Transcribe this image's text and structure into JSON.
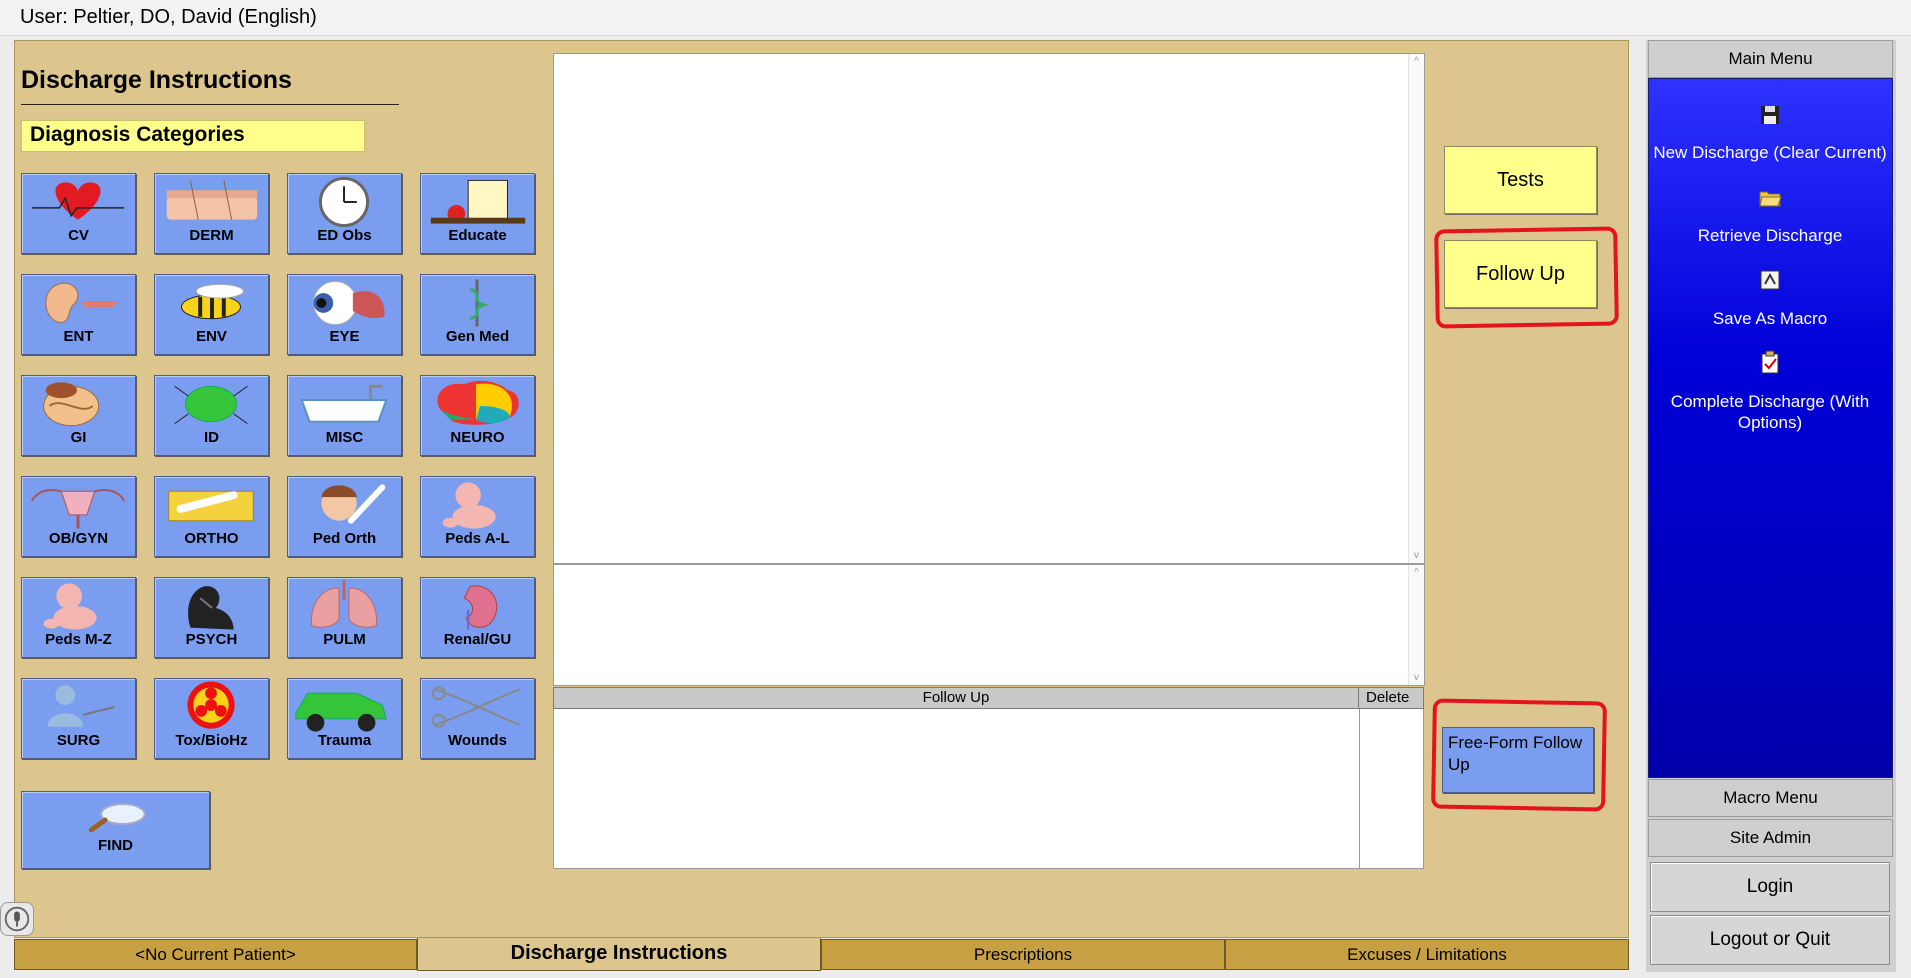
{
  "user_bar": "User: Peltier, DO, David  (English)",
  "left": {
    "title": "Discharge Instructions",
    "category_header": "Diagnosis Categories",
    "categories": [
      {
        "label": "CV",
        "icon": "heart-icon"
      },
      {
        "label": "DERM",
        "icon": "skin-icon"
      },
      {
        "label": "ED Obs",
        "icon": "clock-icon"
      },
      {
        "label": "Educate",
        "icon": "education-icon"
      },
      {
        "label": "ENT",
        "icon": "ear-icon"
      },
      {
        "label": "ENV",
        "icon": "bee-icon"
      },
      {
        "label": "EYE",
        "icon": "eye-icon"
      },
      {
        "label": "Gen Med",
        "icon": "caduceus-icon"
      },
      {
        "label": "GI",
        "icon": "intestines-icon"
      },
      {
        "label": "ID",
        "icon": "germ-icon"
      },
      {
        "label": "MISC",
        "icon": "bathtub-icon"
      },
      {
        "label": "NEURO",
        "icon": "brain-icon"
      },
      {
        "label": "OB/GYN",
        "icon": "uterus-icon"
      },
      {
        "label": "ORTHO",
        "icon": "bone-icon"
      },
      {
        "label": "Ped Orth",
        "icon": "child-bone-icon"
      },
      {
        "label": "Peds A-L",
        "icon": "baby-icon"
      },
      {
        "label": "Peds M-Z",
        "icon": "baby-icon"
      },
      {
        "label": "PSYCH",
        "icon": "thinker-icon"
      },
      {
        "label": "PULM",
        "icon": "lungs-icon"
      },
      {
        "label": "Renal/GU",
        "icon": "kidney-icon"
      },
      {
        "label": "SURG",
        "icon": "surgeon-icon"
      },
      {
        "label": "Tox/BioHz",
        "icon": "biohazard-icon"
      },
      {
        "label": "Trauma",
        "icon": "crashed-car-icon"
      },
      {
        "label": "Wounds",
        "icon": "scissors-icon"
      }
    ],
    "find_label": "FIND"
  },
  "center": {
    "followup_col": "Follow Up",
    "delete_col": "Delete"
  },
  "actions": {
    "tests": "Tests",
    "follow_up": "Follow Up",
    "free_form": "Free-Form Follow Up"
  },
  "right_menu": {
    "main_menu": "Main Menu",
    "items": [
      {
        "label": "New Discharge  (Clear Current)",
        "icon": "floppy-disk-icon"
      },
      {
        "label": "Retrieve Discharge",
        "icon": "folder-open-icon"
      },
      {
        "label": "Save As Macro",
        "icon": "macro-icon"
      },
      {
        "label": "Complete Discharge (With Options)",
        "icon": "clipboard-check-icon"
      }
    ],
    "macro_menu": "Macro Menu",
    "site_admin": "Site Admin",
    "login": "Login",
    "logout": "Logout or Quit"
  },
  "tabs": [
    "<No Current Patient>",
    "Discharge Instructions",
    "Prescriptions",
    "Excuses / Limitations"
  ],
  "colors": {
    "panel": "#dcc68e",
    "category_button": "#7b9df0",
    "highlight_yellow": "#ffff8c",
    "menu_blue": "#0000d8",
    "annotation_red": "#e3141c"
  }
}
